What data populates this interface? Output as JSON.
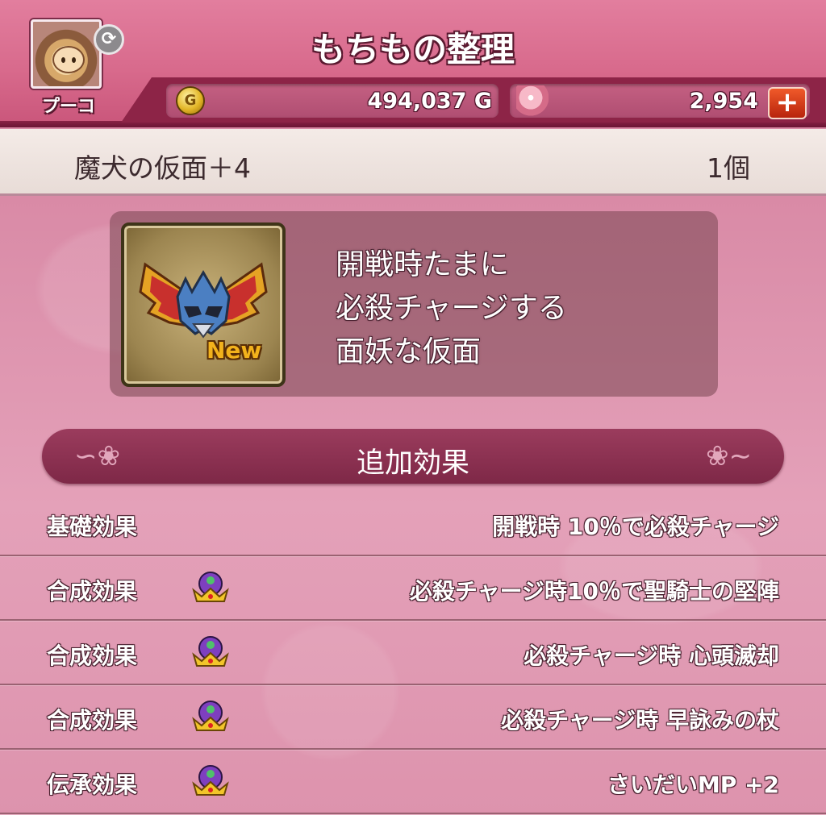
{
  "header": {
    "title": "もちもの整理",
    "player_name": "プーコ",
    "gold_value": "494,037 G",
    "gem_value": "2,954",
    "gold_icon_glyph": "G",
    "add_glyph": "+"
  },
  "item": {
    "name": "魔犬の仮面＋4",
    "count": "1個",
    "badge": "New",
    "description": [
      "開戦時たまに",
      "必殺チャージする",
      "面妖な仮面"
    ]
  },
  "section": {
    "title": "追加効果"
  },
  "effects": [
    {
      "label": "基礎効果",
      "value": "開戦時  10％で必殺チャージ",
      "icon": ""
    },
    {
      "label": "合成効果",
      "value": "必殺チャージ時10％で聖騎士の堅陣",
      "icon": "crown-icon"
    },
    {
      "label": "合成効果",
      "value": "必殺チャージ時  心頭滅却",
      "icon": "crown-icon"
    },
    {
      "label": "合成効果",
      "value": "必殺チャージ時  早詠みの杖",
      "icon": "crown-icon"
    },
    {
      "label": "伝承効果",
      "value": "さいだいMP  +2",
      "icon": "crown-icon"
    }
  ],
  "colors": {
    "header_pink": "#d86a8c",
    "bar_dark": "#8d2447",
    "add_button": "#e0431c"
  }
}
